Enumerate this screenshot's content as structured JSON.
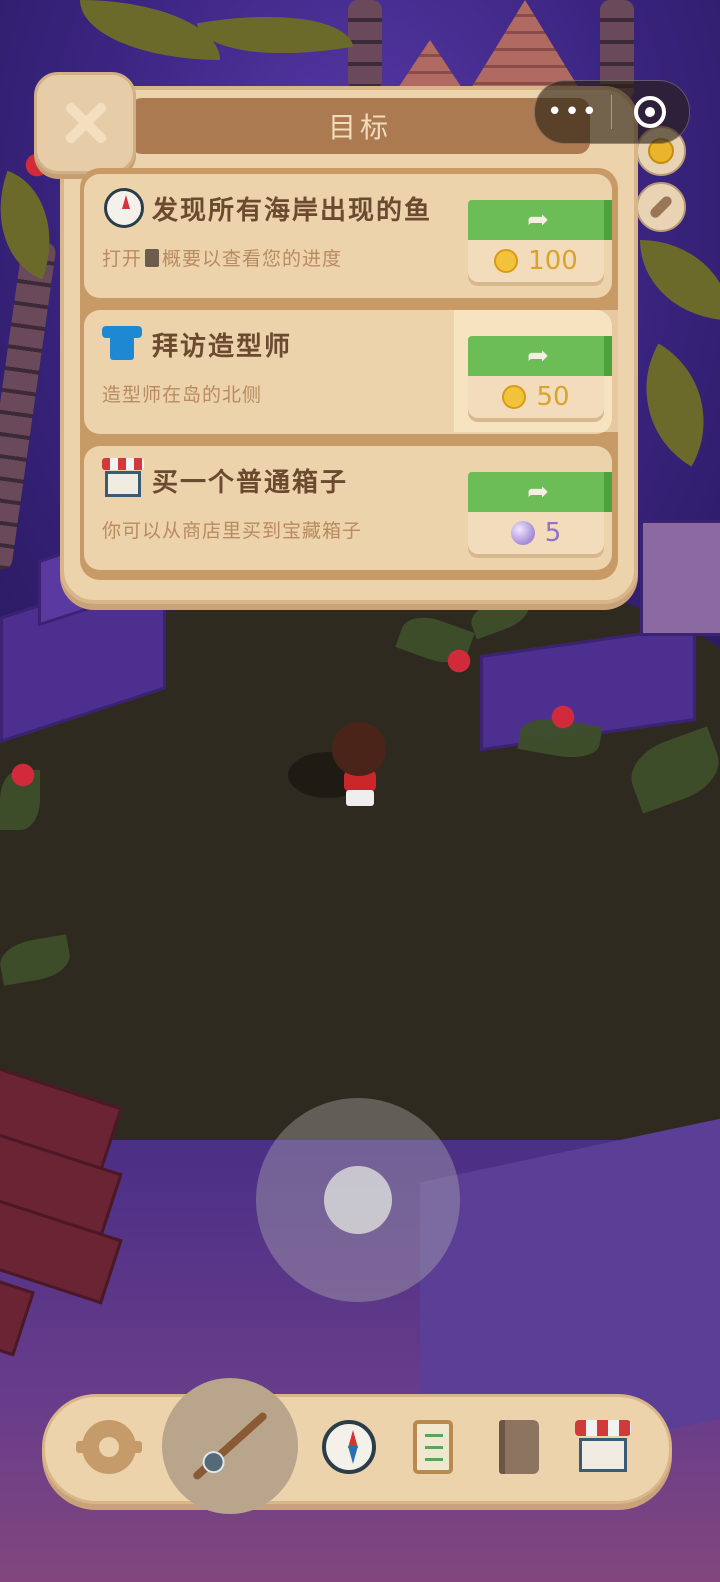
{
  "panel": {
    "title": "目标",
    "goals": [
      {
        "icon": "compass-icon",
        "title": "发现所有海岸出现的鱼",
        "desc_before": "打开",
        "desc_icon": "book-icon",
        "desc_after": "概要以查看您的进度",
        "reward_icon": "coin-icon",
        "reward_amount": "100"
      },
      {
        "icon": "tshirt-icon",
        "title": "拜访造型师",
        "desc": "造型师在岛的北侧",
        "reward_icon": "coin-icon",
        "reward_amount": "50"
      },
      {
        "icon": "shop-icon",
        "title": "买一个普通箱子",
        "desc": "你可以从商店里买到宝藏箱子",
        "reward_icon": "pearl-icon",
        "reward_amount": "5"
      }
    ],
    "go_symbol": "➦"
  },
  "capsule": {
    "more": "•••"
  },
  "toolbar": {
    "items": [
      "settings-gear-icon",
      "fishing-rod-icon",
      "compass-icon",
      "checklist-icon",
      "book-icon",
      "shop-icon"
    ]
  },
  "colors": {
    "panel_bg": "#ecd3ac",
    "header": "#ab7a50",
    "go_button": "#6cbd56",
    "coin": "#f2c33a"
  }
}
